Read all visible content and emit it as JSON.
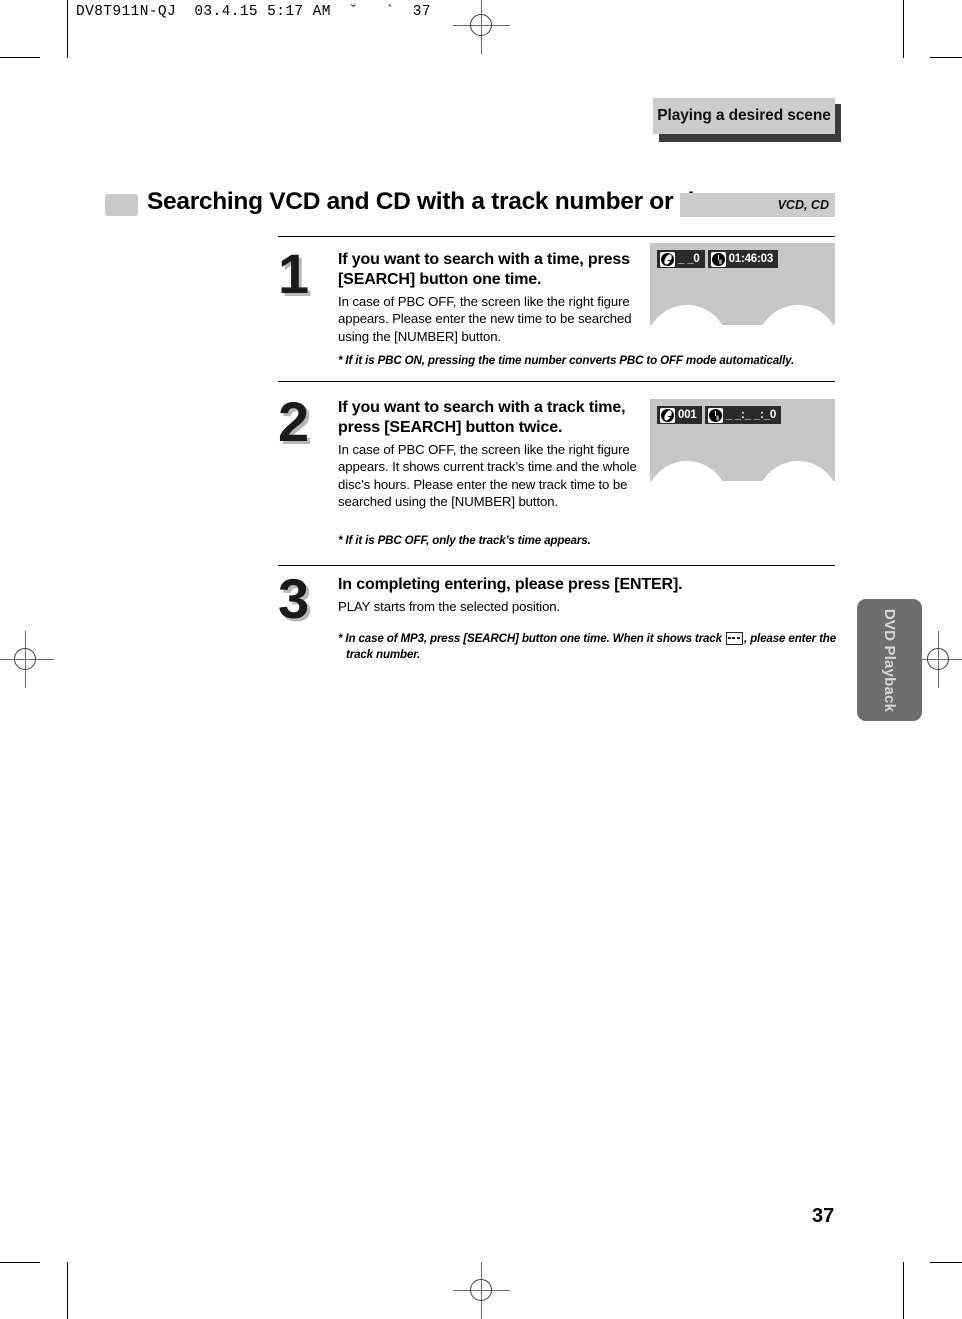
{
  "prepress": {
    "slug": "DV8T911N-QJ  03.4.15 5:17 AM  ˘   `  37"
  },
  "running_head": {
    "label": "Playing a desired scene"
  },
  "section": {
    "title": "Searching VCD and CD with a track number or time",
    "disc_tag": "VCD, CD"
  },
  "steps": [
    {
      "number": "1",
      "heading": "If you want to search with a time, press [SEARCH] button one time.",
      "description": "In case of PBC OFF, the screen like the right figure appears. Please enter the new  time to be searched using the [NUMBER] button.",
      "note": "*  If it is PBC ON, pressing the time number converts PBC to OFF mode automatically.",
      "figure": {
        "track_icon": "disc-icon",
        "track_value": "_ _0",
        "time_icon": "clock-icon",
        "time_value": "01:46:03"
      }
    },
    {
      "number": "2",
      "heading": "If you want to search with a track time, press [SEARCH] button twice.",
      "description": "In case of PBC OFF, the screen like the right figure appears. It shows current track’s time and the whole disc’s hours. Please enter the new  track time to be searched using the [NUMBER] button.",
      "note": "* If it is PBC OFF, only the track’s time appears.",
      "figure": {
        "track_icon": "disc-icon",
        "track_value": "001",
        "time_icon": "clock-icon",
        "time_value": "_ _:_ _:_0"
      }
    },
    {
      "number": "3",
      "heading": "In completing entering, please press [ENTER].",
      "description": "PLAY starts from the selected position.",
      "note_part1": "* In case of MP3, press [SEARCH] button one time. When it shows track",
      "note_glyph": "dashes-box-icon",
      "note_part2": ", please enter the",
      "note_part3": "track number."
    }
  ],
  "side_tab": {
    "label": "DVD Playback"
  },
  "folio": {
    "page_number": "37"
  }
}
